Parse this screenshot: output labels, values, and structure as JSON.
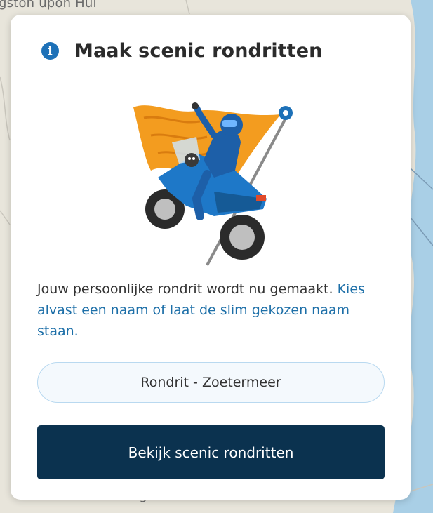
{
  "map": {
    "label_top": "gston upon Hul",
    "label_bottom": "Imtinge"
  },
  "dialog": {
    "title": "Maak scenic rondritten",
    "info_icon_glyph": "i",
    "description_text": "Jouw persoonlijke rondrit wordt nu gemaakt. ",
    "description_link": "Kies alvast een naam of laat de slim gekozen naam staan.",
    "name_value": "Rondrit - Zoetermeer",
    "cta_label": "Bekijk scenic rondritten",
    "colors": {
      "accent": "#1d71b8",
      "link": "#1d6fa8",
      "cta_bg": "#0b324f"
    }
  }
}
